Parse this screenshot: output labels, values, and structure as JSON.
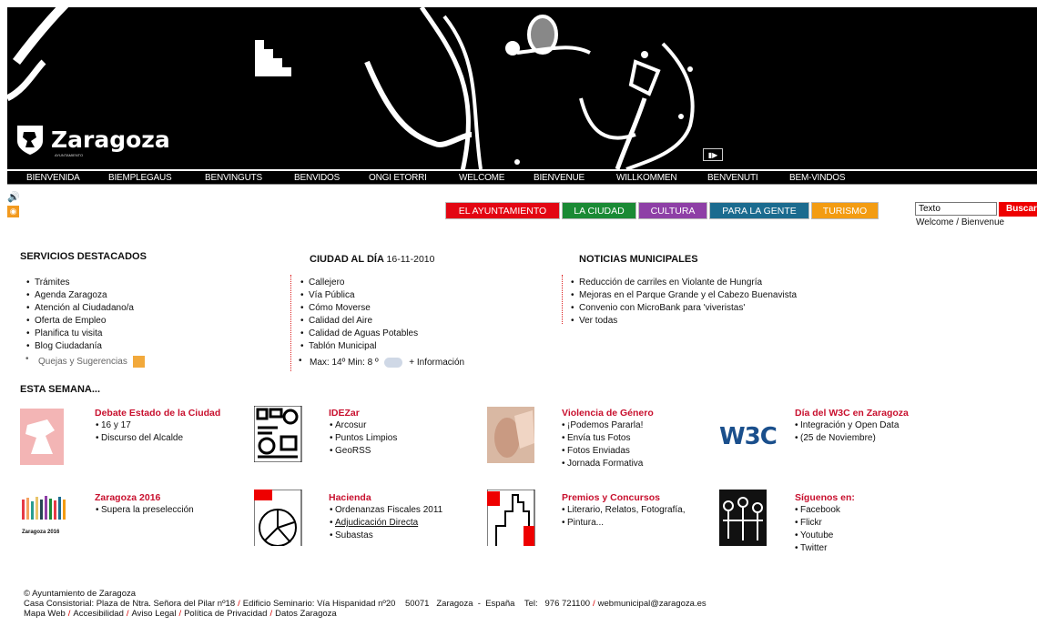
{
  "header": {
    "city_name": "Zaragoza",
    "city_sub": "AYUNTAMIENTO",
    "slideshow_label": "▮▶"
  },
  "languages": [
    "BIENVENIDA",
    "BIEMPLEGAUS",
    "BENVINGUTS",
    "BENVIDOS",
    "ONGI ETORRI",
    "WELCOME",
    "BIENVENUE",
    "WILLKOMMEN",
    "BENVENUTI",
    "BEM-VINDOS"
  ],
  "sections": [
    {
      "label": "EL AYUNTAMIENTO",
      "color": "#e30613"
    },
    {
      "label": "LA CIUDAD",
      "color": "#1a8a34"
    },
    {
      "label": "CULTURA",
      "color": "#8e3fa6"
    },
    {
      "label": "PARA LA GENTE",
      "color": "#1b6b8f"
    },
    {
      "label": "TURISMO",
      "color": "#f39c12"
    }
  ],
  "search": {
    "value": "Texto",
    "button": "Buscar",
    "welcome": "Welcome / Bienvenue"
  },
  "servicios": {
    "title": "SERVICIOS DESTACADOS",
    "items": [
      "Trámites",
      "Agenda Zaragoza",
      "Atención al Ciudadano/a",
      "Oferta de Empleo",
      "Planifica tu visita",
      "Blog Ciudadanía"
    ],
    "quejas": "Quejas y Sugerencias"
  },
  "ciudad": {
    "title": "CIUDAD AL DÍA",
    "date": "16-11-2010",
    "items": [
      "Callejero",
      "Vía Pública",
      "Cómo Moverse",
      "Calidad del Aire",
      "Calidad de Aguas Potables",
      "Tablón Municipal"
    ],
    "weather": "Max: 14º Min: 8 º",
    "weather_more": "+ Información"
  },
  "noticias": {
    "title": "NOTICIAS MUNICIPALES",
    "items": [
      "Reducción de carriles en Violante de Hungría",
      "Mejoras en el Parque Grande y el Cabezo Buenavista",
      "Convenio con MicroBank para 'viveristas'",
      "Ver todas"
    ]
  },
  "semana": {
    "title": "ESTA SEMANA...",
    "items": [
      {
        "title": "Debate Estado de la Ciudad",
        "lines": [
          "16 y 17",
          "Discurso del Alcalde"
        ]
      },
      {
        "title": "IDEZar",
        "lines": [
          "Arcosur",
          "Puntos Limpios",
          "GeoRSS"
        ]
      },
      {
        "title": "Violencia de Género",
        "lines": [
          "¡Podemos Pararla!",
          "Envía tus Fotos",
          "Fotos Enviadas",
          "Jornada Formativa"
        ]
      },
      {
        "title": "Día del W3C en Zaragoza",
        "lines": [
          "Integración y Open Data",
          "(25 de Noviembre)"
        ]
      },
      {
        "title": "Zaragoza 2016",
        "lines": [
          "Supera la preselección"
        ]
      },
      {
        "title": "Hacienda",
        "lines": [
          "Ordenanzas Fiscales 2011",
          "Adjudicación Directa",
          "Subastas"
        ]
      },
      {
        "title": "Premios y Concursos",
        "lines": [
          "Literario, Relatos, Fotografía,",
          "Pintura..."
        ]
      },
      {
        "title": "Síguenos en:",
        "lines": [
          "Facebook",
          "Flickr",
          "Youtube",
          "Twitter"
        ]
      }
    ],
    "w3c_logo": "W3C",
    "z2016_caption": "Zaragoza 2016"
  },
  "footer": {
    "copyright": "©  Ayuntamiento de Zaragoza",
    "addr1": "Casa Consistorial: Plaza de Ntra. Señora del Pilar nº18",
    "addr2": "Edificio Seminario: Vía Hispanidad nº20    50071   Zaragoza  -  España    Tel:   976 721100",
    "email": "webmunicipal@zaragoza.es",
    "links": [
      "Mapa Web",
      "Accesibilidad",
      "Aviso Legal",
      "Política de Privacidad",
      "Datos Zaragoza"
    ]
  }
}
